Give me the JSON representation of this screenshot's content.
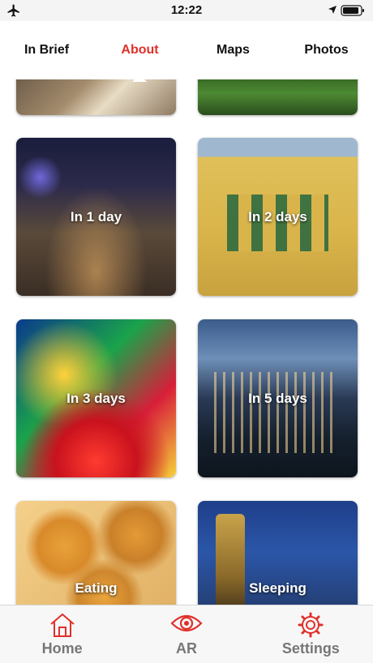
{
  "status_bar": {
    "time": "12:22"
  },
  "top_tabs": [
    {
      "label": "In Brief",
      "active": false
    },
    {
      "label": "About",
      "active": true
    },
    {
      "label": "Maps",
      "active": false
    },
    {
      "label": "Photos",
      "active": false
    }
  ],
  "cards": {
    "day1": "In 1 day",
    "day2": "In 2 days",
    "day3": "In 3 days",
    "day5": "In 5 days",
    "eating": "Eating",
    "sleeping": "Sleeping"
  },
  "bottom_tabs": {
    "home": "Home",
    "ar": "AR",
    "settings": "Settings"
  },
  "colors": {
    "accent": "#e0302a",
    "tab_inactive": "#777777"
  }
}
